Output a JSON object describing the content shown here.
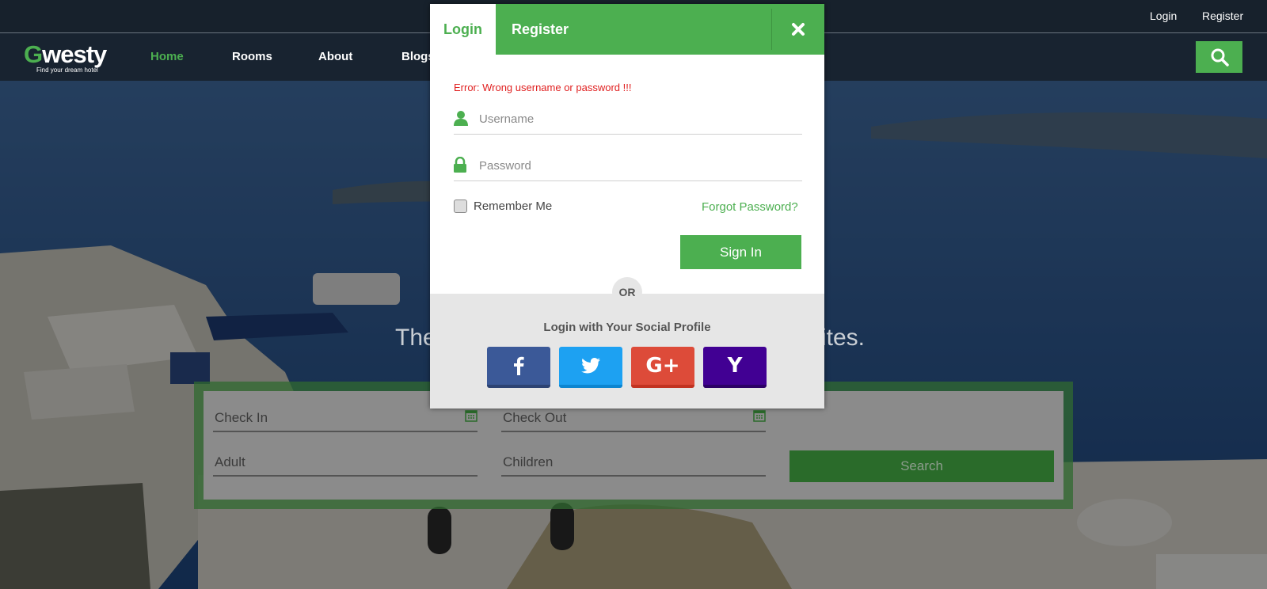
{
  "topbar": {
    "login": "Login",
    "register": "Register"
  },
  "logo": {
    "letter": "G",
    "rest": "westy",
    "tagline": "Find your dream hotel"
  },
  "nav": [
    {
      "label": "Home",
      "active": true
    },
    {
      "label": "Rooms",
      "active": false
    },
    {
      "label": "About",
      "active": false
    },
    {
      "label": "Blogs",
      "active": false
    }
  ],
  "hero": {
    "tagline_left": "The",
    "tagline_right": "sites."
  },
  "booking": {
    "check_in": "Check In",
    "check_out": "Check Out",
    "adult": "Adult",
    "children": "Children",
    "search": "Search"
  },
  "modal": {
    "tab_login": "Login",
    "tab_register": "Register",
    "error": "Error: Wrong username or password !!!",
    "username_placeholder": "Username",
    "password_placeholder": "Password",
    "remember": "Remember Me",
    "forgot": "Forgot Password?",
    "signin": "Sign In",
    "or": "OR",
    "social_title": "Login with Your Social Profile",
    "social": {
      "google_label": "G+",
      "yahoo_label": "Y"
    }
  },
  "colors": {
    "brand_green": "#4caf50",
    "error_red": "#e02020",
    "facebook": "#3b5998",
    "twitter": "#1da1f2",
    "google": "#dd4b39",
    "yahoo": "#410093"
  }
}
